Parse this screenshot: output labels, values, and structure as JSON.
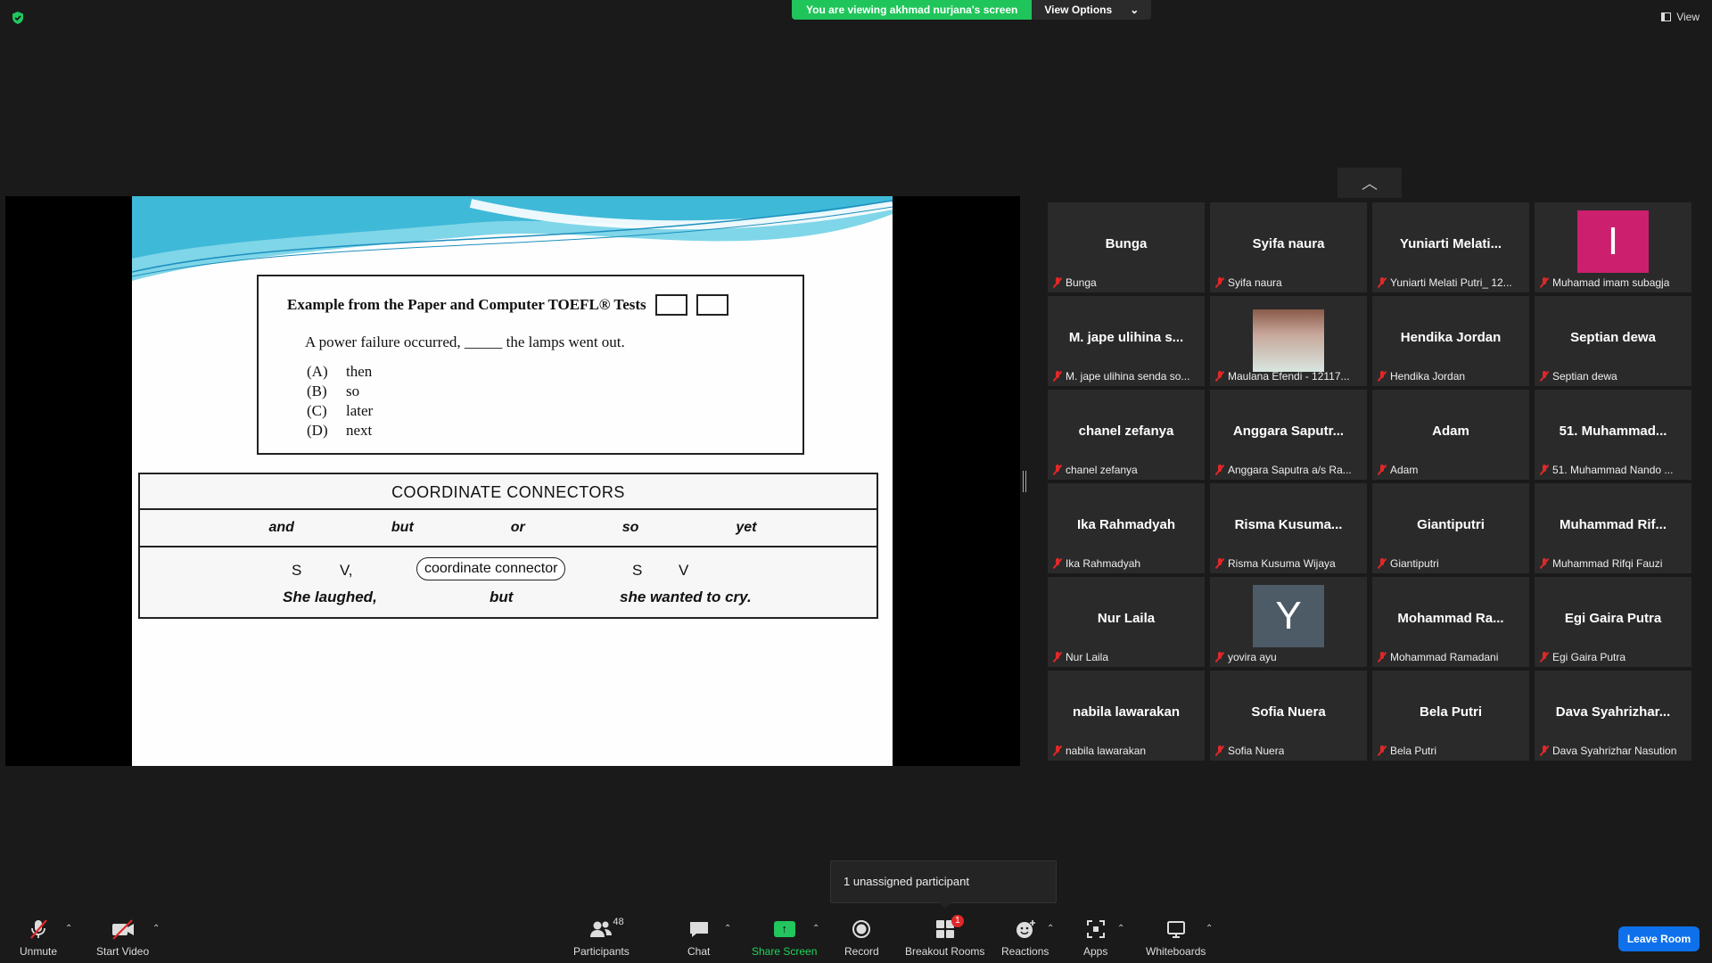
{
  "top": {
    "viewing_text": "You are viewing akhmad nurjana's screen",
    "view_options": "View Options",
    "view_label": "View"
  },
  "slide": {
    "toefl_title": "Example from the Paper and Computer TOEFL® Tests",
    "question": "A power failure occurred, _____ the lamps went out.",
    "options": [
      {
        "letter": "(A)",
        "text": "then"
      },
      {
        "letter": "(B)",
        "text": "so"
      },
      {
        "letter": "(C)",
        "text": "later"
      },
      {
        "letter": "(D)",
        "text": "next"
      }
    ],
    "cc_title": "COORDINATE CONNECTORS",
    "connectors": [
      "and",
      "but",
      "or",
      "so",
      "yet"
    ],
    "formula": {
      "s1": "S",
      "v1": "V,",
      "connector": "coordinate connector",
      "s2": "S",
      "v2": "V"
    },
    "example": {
      "part1": "She laughed,",
      "part2": "but",
      "part3": "she wanted to cry."
    }
  },
  "gallery": [
    {
      "name": "Bunga",
      "label": "Bunga"
    },
    {
      "name": "Syifa naura",
      "label": "Syifa naura"
    },
    {
      "name": "Yuniarti  Melati...",
      "label": "Yuniarti Melati Putri_ 12..."
    },
    {
      "name": "",
      "label": "Muhamad imam subagja",
      "avatar": "I",
      "avatar_color": "#cc1f6e"
    },
    {
      "name": "M. jape ulihina s...",
      "label": "M. jape ulihina senda so..."
    },
    {
      "name": "",
      "label": "Maulana Efendi - 12117...",
      "photo": true
    },
    {
      "name": "Hendika Jordan",
      "label": "Hendika Jordan"
    },
    {
      "name": "Septian dewa",
      "label": "Septian dewa"
    },
    {
      "name": "chanel zefanya",
      "label": "chanel zefanya"
    },
    {
      "name": "Anggara  Saputr...",
      "label": "Anggara Saputra a/s Ra..."
    },
    {
      "name": "Adam",
      "label": "Adam"
    },
    {
      "name": "51.  Muhammad...",
      "label": "51. Muhammad Nando ..."
    },
    {
      "name": "Ika Rahmadyah",
      "label": "Ika Rahmadyah"
    },
    {
      "name": "Risma  Kusuma...",
      "label": "Risma Kusuma Wijaya"
    },
    {
      "name": "Giantiputri",
      "label": "Giantiputri"
    },
    {
      "name": "Muhammad  Rif...",
      "label": "Muhammad Rifqi Fauzi"
    },
    {
      "name": "Nur Laila",
      "label": "Nur Laila"
    },
    {
      "name": "",
      "label": "yovira ayu",
      "avatar": "Y",
      "avatar_color": "#4d5b66"
    },
    {
      "name": "Mohammad  Ra...",
      "label": "Mohammad Ramadani"
    },
    {
      "name": "Egi Gaira Putra",
      "label": "Egi Gaira Putra"
    },
    {
      "name": "nabila lawarakan",
      "label": "nabila lawarakan"
    },
    {
      "name": "Sofia Nuera",
      "label": "Sofia Nuera"
    },
    {
      "name": "Bela Putri",
      "label": "Bela Putri"
    },
    {
      "name": "Dava  Syahrizhar...",
      "label": "Dava Syahrizhar Nasution"
    }
  ],
  "unassigned": "1 unassigned participant",
  "toolbar": {
    "unmute": "Unmute",
    "start_video": "Start Video",
    "participants": "Participants",
    "participants_count": "48",
    "chat": "Chat",
    "share_screen": "Share Screen",
    "record": "Record",
    "breakout_rooms": "Breakout Rooms",
    "breakout_badge": "1",
    "reactions": "Reactions",
    "apps": "Apps",
    "whiteboards": "Whiteboards",
    "leave_room": "Leave Room"
  },
  "colors": {
    "accent_green": "#22c55e",
    "leave_blue": "#0e71eb",
    "muted_red": "#e02828"
  }
}
